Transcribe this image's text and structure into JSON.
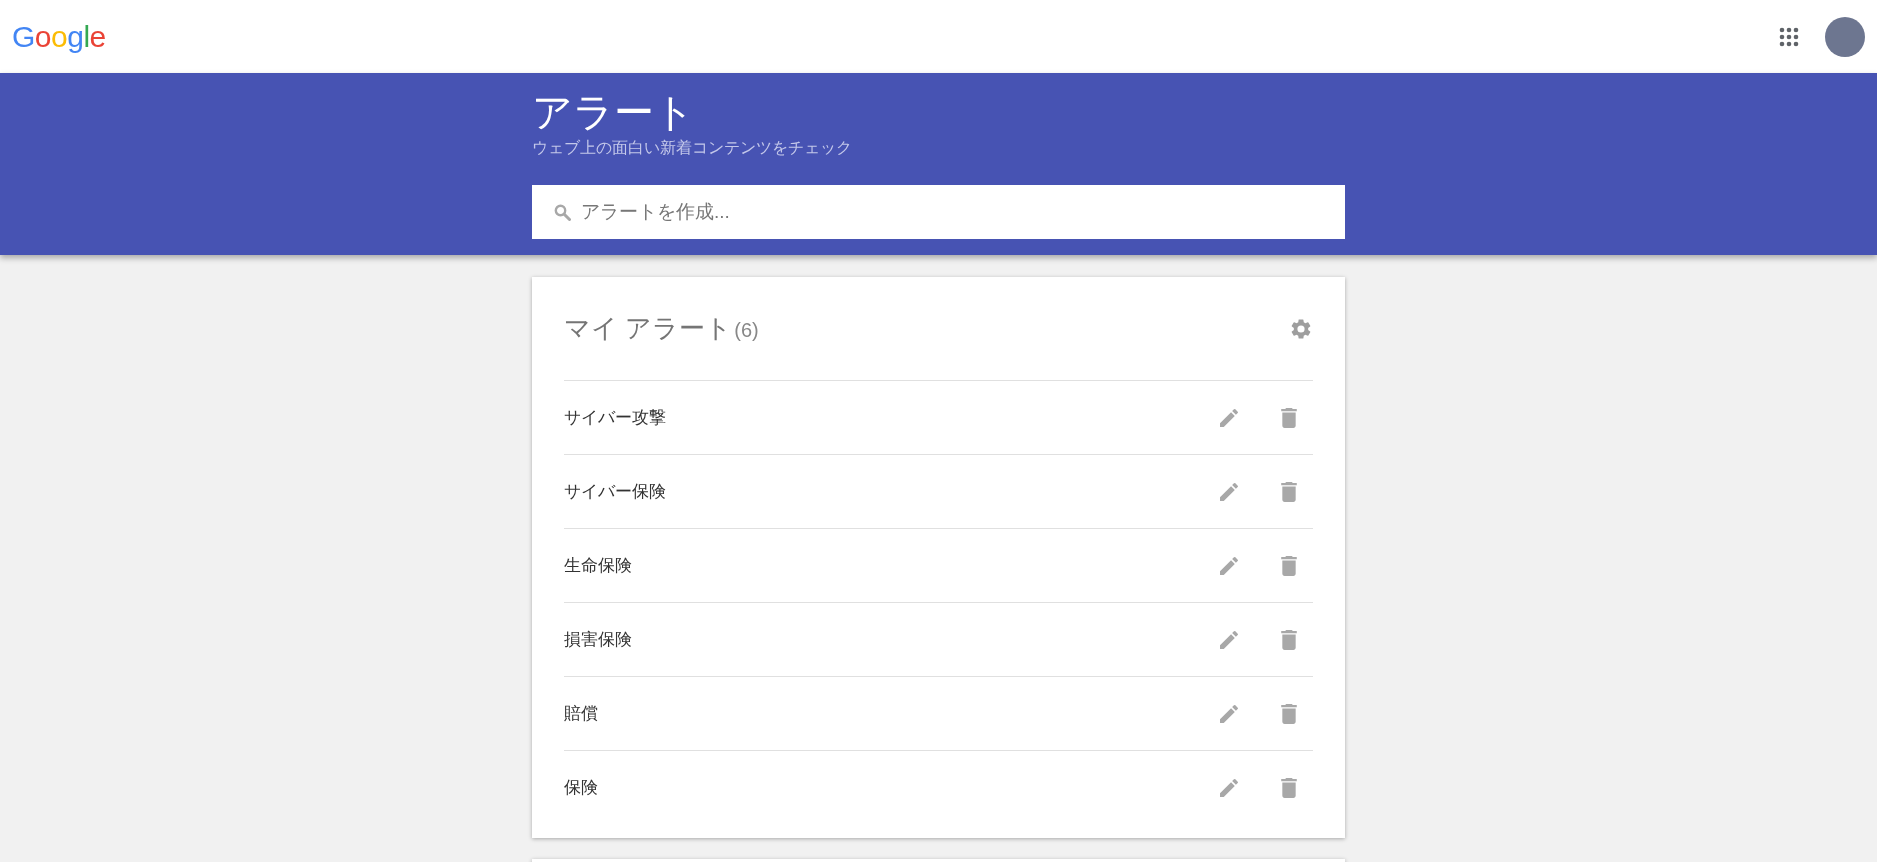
{
  "topbar": {
    "logo": "Google"
  },
  "header": {
    "title": "アラート",
    "subtitle": "ウェブ上の面白い新着コンテンツをチェック",
    "search": {
      "placeholder": "アラートを作成..."
    }
  },
  "my_alerts": {
    "title": "マイ アラート",
    "count": "(6)",
    "alerts": [
      {
        "name": "サイバー攻撃"
      },
      {
        "name": "サイバー保険"
      },
      {
        "name": "生命保険"
      },
      {
        "name": "損害保険"
      },
      {
        "name": "賠償"
      },
      {
        "name": "保険"
      }
    ]
  }
}
